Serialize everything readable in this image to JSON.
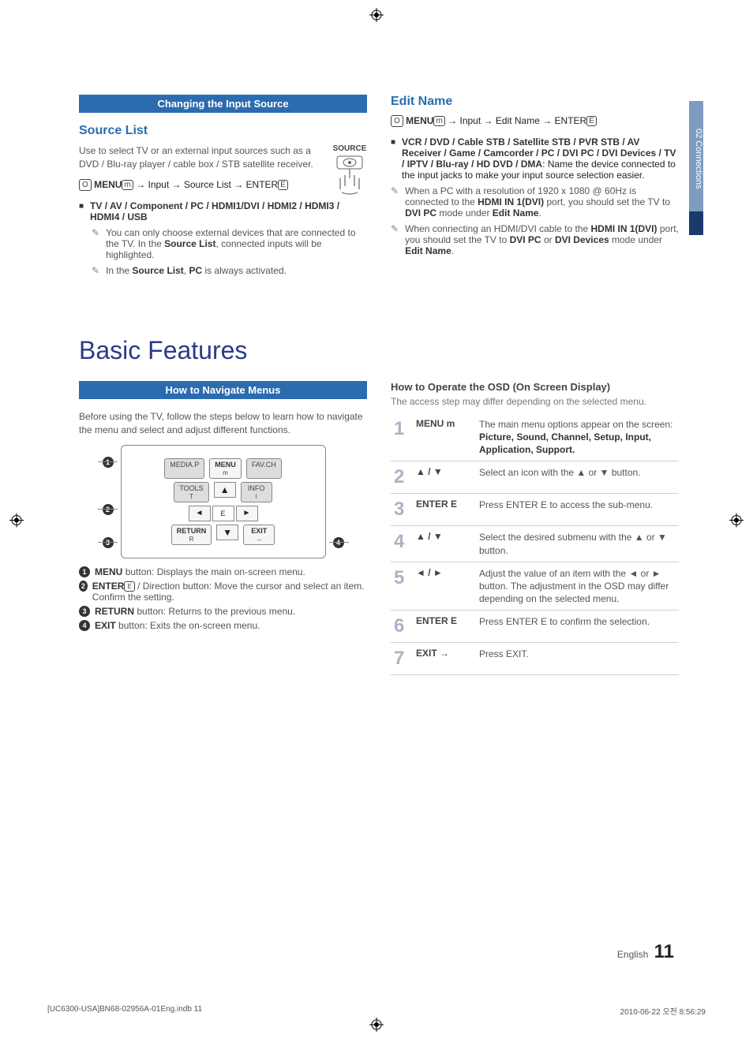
{
  "sideTab": {
    "label": "02  Connections"
  },
  "top": {
    "sectionBar": "Changing the Input Source",
    "sourceList": {
      "heading": "Source List",
      "intro": "Use to select TV or an external input sources such as a DVD / Blu-ray player / cable box / STB satellite receiver.",
      "menuPath": {
        "prefix": "MENU",
        "path": " → Input → Source List → ENTER"
      },
      "sourceIconLabel": "SOURCE",
      "bullet1": "TV / AV / Component / PC / HDMI1/DVI / HDMI2 / HDMI3 / HDMI4 / USB",
      "note1": "You can only choose external devices that are connected to the TV. In the Source List, connected inputs will be highlighted.",
      "note2": "In the Source List, PC is always activated."
    },
    "editName": {
      "heading": "Edit Name",
      "menuPath": {
        "prefix": "MENU",
        "path": " → Input → Edit Name → ENTER"
      },
      "bullet1": "VCR / DVD / Cable STB / Satellite STB / PVR STB / AV Receiver / Game / Camcorder / PC / DVI PC / DVI Devices / TV / IPTV / Blu-ray / HD DVD / DMA: Name the device connected to the input jacks to make your input source selection easier.",
      "note1": "When a PC with a resolution of 1920 x 1080 @ 60Hz is connected to the HDMI IN 1(DVI) port, you should set the TV to DVI PC mode under Edit Name.",
      "note2": "When connecting an HDMI/DVI cable to the HDMI IN 1(DVI) port, you should set the TV to DVI PC or DVI Devices mode under Edit Name."
    }
  },
  "bigTitle": "Basic Features",
  "navigate": {
    "sectionBar": "How to Navigate Menus",
    "intro": "Before using the TV, follow the steps below to learn how to navigate the menu and select and adjust different functions.",
    "remote": {
      "mediaP": "MEDIA.P",
      "menu": "MENU",
      "favch": "FAV.CH",
      "tools": "TOOLS",
      "info": "INFO",
      "return": "RETURN",
      "exit": "EXIT",
      "enter": "E"
    },
    "callouts": {
      "c1": "MENU button: Displays the main on-screen menu.",
      "c2": "ENTER E / Direction button: Move the cursor and select an item. Confirm the setting.",
      "c3": "RETURN button: Returns to the previous menu.",
      "c4": "EXIT button: Exits the on-screen menu."
    }
  },
  "osd": {
    "title": "How to Operate the OSD (On Screen Display)",
    "sub": "The access step may differ depending on the selected menu.",
    "rows": [
      {
        "n": "1",
        "key": "MENU m",
        "desc": "The main menu options appear on the screen:\nPicture, Sound, Channel, Setup, Input, Application, Support."
      },
      {
        "n": "2",
        "key": "▲ / ▼",
        "desc": "Select an icon with the ▲ or ▼ button."
      },
      {
        "n": "3",
        "key": "ENTER E",
        "desc": "Press ENTER E to access the sub-menu."
      },
      {
        "n": "4",
        "key": "▲ / ▼",
        "desc": "Select the desired submenu with the ▲ or ▼ button."
      },
      {
        "n": "5",
        "key": "◄ / ►",
        "desc": "Adjust the value of an item with the ◄ or ► button. The adjustment in the OSD may differ depending on the selected menu."
      },
      {
        "n": "6",
        "key": "ENTER E",
        "desc": "Press ENTER E to confirm the selection."
      },
      {
        "n": "7",
        "key": "EXIT →",
        "desc": "Press EXIT."
      }
    ]
  },
  "footer": {
    "lang": "English",
    "page": "11",
    "file": "[UC6300-USA]BN68-02956A-01Eng.indb   11",
    "stamp": "2010-06-22   오전 8:56:29"
  }
}
